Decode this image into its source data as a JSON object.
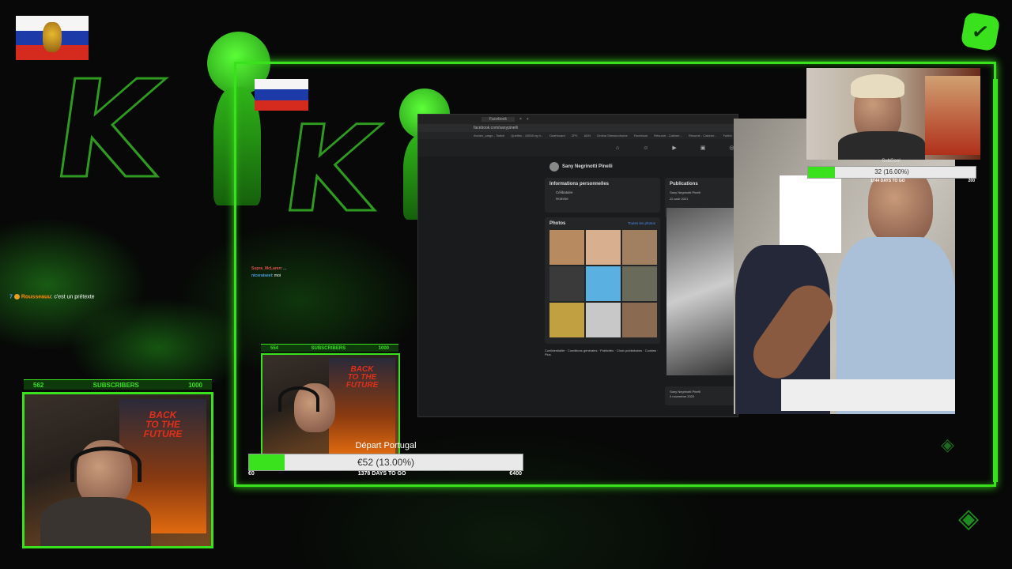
{
  "chat": {
    "left_line": {
      "badge": "7",
      "name": "Rousseauu",
      "message": ": c'est un prétexte"
    },
    "inner_lines": [
      {
        "name": "Supra_McLaren",
        "message": ": ..."
      },
      {
        "name": "niceraiseet",
        "message": ": moi"
      }
    ]
  },
  "subscribers_left": {
    "start": "562",
    "label": "SUBSCRIBERS",
    "end": "1000"
  },
  "subscribers_inner": {
    "start": "554",
    "label": "SUBSCRIBERS",
    "end": "1000"
  },
  "goal": {
    "title": "Départ Portugal",
    "amount_text": "€52 (13.00%)",
    "progress": 0.13,
    "min": "€0",
    "footer": "1378 DAYS TO GO",
    "max": "€400"
  },
  "subgoal": {
    "title": "SubGoal",
    "amount_text": "32 (16.00%)",
    "progress": 0.16,
    "footer": "1744 DAYS TO GO",
    "max": "200"
  },
  "browser": {
    "tab_title": "Facebook",
    "url": "facebook.com/sanypinelli",
    "bookmarks": [
      "Ancien_cargo - Twitch",
      "Quéltéu - 10539 ng h...",
      "Dashboard",
      "ZPX",
      "ADN",
      "Ordina Shewmohome",
      "Facebook",
      "Résumé - Cabiner...",
      "Résumé - Cabiner...",
      "Twitch"
    ],
    "profile_name": "Sany Negrinotti Pinelli",
    "about_title": "Informations personnelles",
    "about_items": [
      "Célibataire",
      "Homme"
    ],
    "photos_title": "Photos",
    "photos_link": "Toutes les photos",
    "publications_title": "Publications",
    "post_author": "Sany Negrinotti Pinelli",
    "post_date": "22 août 2021",
    "post2_date": "3 novembre 2020",
    "footer": "Confidentialité · Conditions générales · Publicités · Choix publicitaires · Cookies · Plus"
  },
  "colors": {
    "accent": "#39e21c",
    "chat_name": "#ff8c00"
  },
  "icons": [
    "checkmark-icon",
    "russian-flag-icon",
    "ethereum-icon"
  ]
}
